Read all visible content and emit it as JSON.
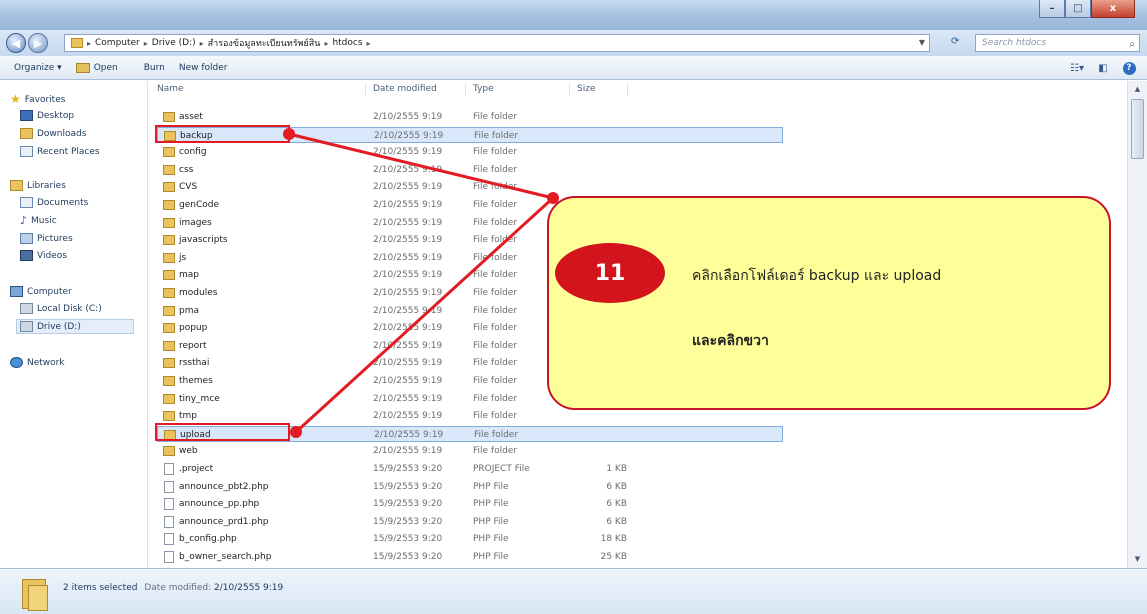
{
  "titlebar": {
    "buttons": [
      "–",
      "□",
      "x"
    ]
  },
  "address": {
    "crumbs": [
      "Computer",
      "Drive (D:)",
      "สำรองข้อมูลทะเบียนทรัพย์สิน",
      "htdocs"
    ],
    "search_placeholder": "Search htdocs"
  },
  "toolbar": {
    "organize": "Organize ▾",
    "open": "Open",
    "burn": "Burn",
    "new_folder": "New folder"
  },
  "nav": {
    "favorites": "Favorites",
    "desktop": "Desktop",
    "downloads": "Downloads",
    "recent": "Recent Places",
    "libraries": "Libraries",
    "documents": "Documents",
    "music": "Music",
    "pictures": "Pictures",
    "videos": "Videos",
    "computer": "Computer",
    "local_disk": "Local Disk (C:)",
    "drive_d": "Drive (D:)",
    "network": "Network"
  },
  "columns": {
    "name": "Name",
    "date": "Date modified",
    "type": "Type",
    "size": "Size"
  },
  "rows": [
    {
      "name": "asset",
      "date": "2/10/2555 9:19",
      "type": "File folder",
      "size": "",
      "kind": "folder",
      "selected": false
    },
    {
      "name": "backup",
      "date": "2/10/2555 9:19",
      "type": "File folder",
      "size": "",
      "kind": "folder",
      "selected": true
    },
    {
      "name": "config",
      "date": "2/10/2555 9:19",
      "type": "File folder",
      "size": "",
      "kind": "folder",
      "selected": false
    },
    {
      "name": "css",
      "date": "2/10/2555 9:19",
      "type": "File folder",
      "size": "",
      "kind": "folder",
      "selected": false
    },
    {
      "name": "CVS",
      "date": "2/10/2555 9:19",
      "type": "File folder",
      "size": "",
      "kind": "folder",
      "selected": false
    },
    {
      "name": "genCode",
      "date": "2/10/2555 9:19",
      "type": "File folder",
      "size": "",
      "kind": "folder",
      "selected": false
    },
    {
      "name": "images",
      "date": "2/10/2555 9:19",
      "type": "File folder",
      "size": "",
      "kind": "folder",
      "selected": false
    },
    {
      "name": "javascripts",
      "date": "2/10/2555 9:19",
      "type": "File folder",
      "size": "",
      "kind": "folder",
      "selected": false
    },
    {
      "name": "js",
      "date": "2/10/2555 9:19",
      "type": "File folder",
      "size": "",
      "kind": "folder",
      "selected": false
    },
    {
      "name": "map",
      "date": "2/10/2555 9:19",
      "type": "File folder",
      "size": "",
      "kind": "folder",
      "selected": false
    },
    {
      "name": "modules",
      "date": "2/10/2555 9:19",
      "type": "File folder",
      "size": "",
      "kind": "folder",
      "selected": false
    },
    {
      "name": "pma",
      "date": "2/10/2555 9:19",
      "type": "File folder",
      "size": "",
      "kind": "folder",
      "selected": false
    },
    {
      "name": "popup",
      "date": "2/10/2555 9:19",
      "type": "File folder",
      "size": "",
      "kind": "folder",
      "selected": false
    },
    {
      "name": "report",
      "date": "2/10/2555 9:19",
      "type": "File folder",
      "size": "",
      "kind": "folder",
      "selected": false
    },
    {
      "name": "rssthai",
      "date": "2/10/2555 9:19",
      "type": "File folder",
      "size": "",
      "kind": "folder",
      "selected": false
    },
    {
      "name": "themes",
      "date": "2/10/2555 9:19",
      "type": "File folder",
      "size": "",
      "kind": "folder",
      "selected": false
    },
    {
      "name": "tiny_mce",
      "date": "2/10/2555 9:19",
      "type": "File folder",
      "size": "",
      "kind": "folder",
      "selected": false
    },
    {
      "name": "tmp",
      "date": "2/10/2555 9:19",
      "type": "File folder",
      "size": "",
      "kind": "folder",
      "selected": false
    },
    {
      "name": "upload",
      "date": "2/10/2555 9:19",
      "type": "File folder",
      "size": "",
      "kind": "folder",
      "selected": true
    },
    {
      "name": "web",
      "date": "2/10/2555 9:19",
      "type": "File folder",
      "size": "",
      "kind": "folder",
      "selected": false
    },
    {
      "name": ".project",
      "date": "15/9/2553 9:20",
      "type": "PROJECT File",
      "size": "1 KB",
      "kind": "file",
      "selected": false
    },
    {
      "name": "announce_pbt2.php",
      "date": "15/9/2553 9:20",
      "type": "PHP File",
      "size": "6 KB",
      "kind": "file",
      "selected": false
    },
    {
      "name": "announce_pp.php",
      "date": "15/9/2553 9:20",
      "type": "PHP File",
      "size": "6 KB",
      "kind": "file",
      "selected": false
    },
    {
      "name": "announce_prd1.php",
      "date": "15/9/2553 9:20",
      "type": "PHP File",
      "size": "6 KB",
      "kind": "file",
      "selected": false
    },
    {
      "name": "b_config.php",
      "date": "15/9/2553 9:20",
      "type": "PHP File",
      "size": "18 KB",
      "kind": "file",
      "selected": false
    },
    {
      "name": "b_owner_search.php",
      "date": "15/9/2553 9:20",
      "type": "PHP File",
      "size": "25 KB",
      "kind": "file",
      "selected": false
    }
  ],
  "status": {
    "selection": "2 items selected",
    "date_label": "Date modified:",
    "date_value": "2/10/2555 9:19"
  },
  "callout": {
    "step": "11",
    "line1": "คลิกเลือกโฟล์เดอร์ backup และ upload",
    "line2": "และคลิกขวา",
    "accent": "#d3141c",
    "fill": "#ffff99"
  }
}
